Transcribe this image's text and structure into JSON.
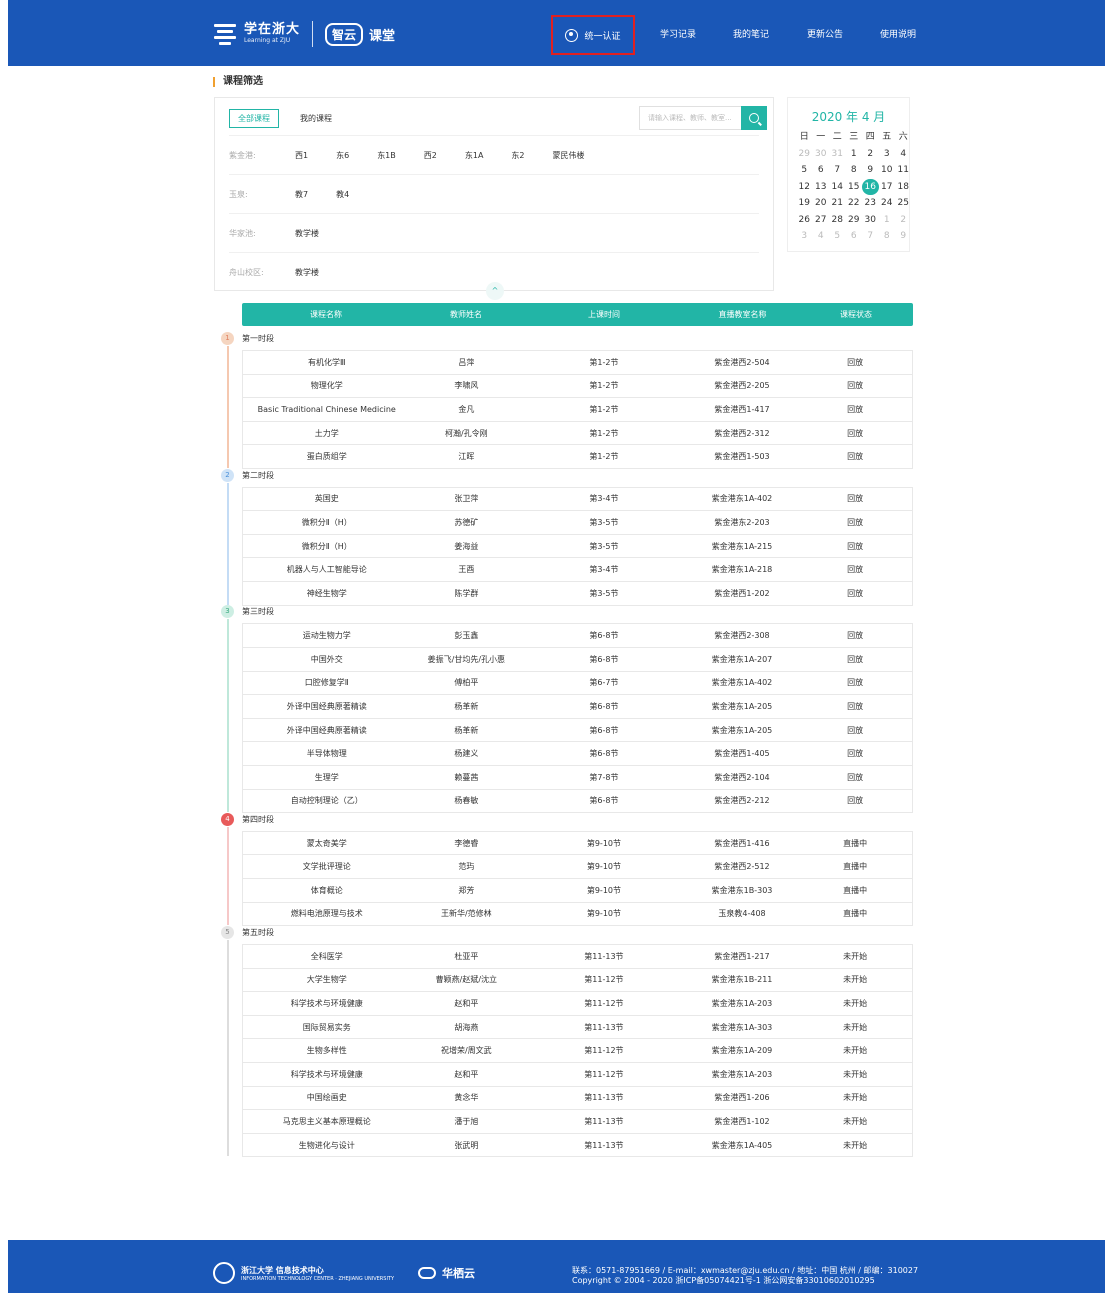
{
  "header": {
    "brand_text": "学在浙大",
    "brand_sub": "Learning at ZJU",
    "brand_zhiyun": "智云",
    "brand_ketang": "课堂",
    "auth_label": "统一认证",
    "nav": [
      "学习记录",
      "我的笔记",
      "更新公告",
      "使用说明"
    ]
  },
  "filter": {
    "title": "课程筛选",
    "tabs": [
      "全部课程",
      "我的课程"
    ],
    "search_placeholder": "请输入课程、教师、教室...",
    "rows": [
      {
        "label": "紫金港:",
        "options": [
          "西1",
          "东6",
          "东1B",
          "西2",
          "东1A",
          "东2",
          "蒙民伟楼"
        ]
      },
      {
        "label": "玉泉:",
        "options": [
          "教7",
          "教4"
        ]
      },
      {
        "label": "华家池:",
        "options": [
          "教学楼"
        ]
      },
      {
        "label": "舟山校区:",
        "options": [
          "教学楼"
        ]
      }
    ],
    "collapse_icon": "^"
  },
  "calendar": {
    "title": "2020 年 4 月",
    "weekdays": [
      "日",
      "一",
      "二",
      "三",
      "四",
      "五",
      "六"
    ],
    "days": [
      {
        "d": "29",
        "dim": true
      },
      {
        "d": "30",
        "dim": true
      },
      {
        "d": "31",
        "dim": true
      },
      {
        "d": "1"
      },
      {
        "d": "2"
      },
      {
        "d": "3"
      },
      {
        "d": "4"
      },
      {
        "d": "5"
      },
      {
        "d": "6"
      },
      {
        "d": "7"
      },
      {
        "d": "8"
      },
      {
        "d": "9"
      },
      {
        "d": "10"
      },
      {
        "d": "11"
      },
      {
        "d": "12"
      },
      {
        "d": "13"
      },
      {
        "d": "14"
      },
      {
        "d": "15"
      },
      {
        "d": "16",
        "today": true
      },
      {
        "d": "17"
      },
      {
        "d": "18"
      },
      {
        "d": "19"
      },
      {
        "d": "20"
      },
      {
        "d": "21"
      },
      {
        "d": "22"
      },
      {
        "d": "23"
      },
      {
        "d": "24"
      },
      {
        "d": "25"
      },
      {
        "d": "26"
      },
      {
        "d": "27"
      },
      {
        "d": "28"
      },
      {
        "d": "29"
      },
      {
        "d": "30"
      },
      {
        "d": "1",
        "dim": true
      },
      {
        "d": "2",
        "dim": true
      },
      {
        "d": "3",
        "dim": true
      },
      {
        "d": "4",
        "dim": true
      },
      {
        "d": "5",
        "dim": true
      },
      {
        "d": "6",
        "dim": true
      },
      {
        "d": "7",
        "dim": true
      },
      {
        "d": "8",
        "dim": true
      },
      {
        "d": "9",
        "dim": true
      }
    ]
  },
  "table": {
    "headers": [
      "课程名称",
      "教师姓名",
      "上课时间",
      "直播教室名称",
      "课程状态"
    ],
    "periods": [
      {
        "num": "1",
        "label": "第一时段",
        "color": "#f5d5c0",
        "badge_text": "#e08060",
        "line": "#f5c8b0",
        "rows": [
          [
            "有机化学Ⅲ",
            "吕萍",
            "第1-2节",
            "紫金港西2-504",
            "回放"
          ],
          [
            "物理化学",
            "李啸风",
            "第1-2节",
            "紫金港西2-205",
            "回放"
          ],
          [
            "Basic Traditional Chinese Medicine",
            "金凡",
            "第1-2节",
            "紫金港西1-417",
            "回放"
          ],
          [
            "土力学",
            "柯瀚/孔令刚",
            "第1-2节",
            "紫金港西2-312",
            "回放"
          ],
          [
            "蛋白质组学",
            "江晖",
            "第1-2节",
            "紫金港西1-503",
            "回放"
          ]
        ]
      },
      {
        "num": "2",
        "label": "第二时段",
        "color": "#cfe3f7",
        "badge_text": "#4a90d9",
        "line": "#c4dcf5",
        "rows": [
          [
            "英国史",
            "张卫萍",
            "第3-4节",
            "紫金港东1A-402",
            "回放"
          ],
          [
            "微积分Ⅱ（H）",
            "苏德矿",
            "第3-5节",
            "紫金港东2-203",
            "回放"
          ],
          [
            "微积分Ⅱ（H）",
            "姜海益",
            "第3-5节",
            "紫金港东1A-215",
            "回放"
          ],
          [
            "机器人与人工智能导论",
            "王酉",
            "第3-4节",
            "紫金港东1A-218",
            "回放"
          ],
          [
            "神经生物学",
            "陈学群",
            "第3-5节",
            "紫金港西1-202",
            "回放"
          ]
        ]
      },
      {
        "num": "3",
        "label": "第三时段",
        "color": "#cdeee3",
        "badge_text": "#3aaa80",
        "line": "#bfe8da",
        "rows": [
          [
            "运动生物力学",
            "彭玉鑫",
            "第6-8节",
            "紫金港西2-308",
            "回放"
          ],
          [
            "中国外交",
            "姜振飞/甘均先/孔小惠",
            "第6-8节",
            "紫金港东1A-207",
            "回放"
          ],
          [
            "口腔修复学Ⅱ",
            "傅柏平",
            "第6-7节",
            "紫金港东1A-402",
            "回放"
          ],
          [
            "外译中国经典原著精读",
            "杨革新",
            "第6-8节",
            "紫金港东1A-205",
            "回放"
          ],
          [
            "外译中国经典原著精读",
            "杨革新",
            "第6-8节",
            "紫金港东1A-205",
            "回放"
          ],
          [
            "半导体物理",
            "杨建义",
            "第6-8节",
            "紫金港西1-405",
            "回放"
          ],
          [
            "生理学",
            "赖蔓茜",
            "第7-8节",
            "紫金港西2-104",
            "回放"
          ],
          [
            "自动控制理论（乙）",
            "杨春敏",
            "第6-8节",
            "紫金港西2-212",
            "回放"
          ]
        ]
      },
      {
        "num": "4",
        "label": "第四时段",
        "color": "#e85a5a",
        "badge_text": "#ffffff",
        "line": "#f6c8c8",
        "rows": [
          [
            "蒙太奇美学",
            "李德睿",
            "第9-10节",
            "紫金港西1-416",
            "直播中"
          ],
          [
            "文学批评理论",
            "范玙",
            "第9-10节",
            "紫金港西2-512",
            "直播中"
          ],
          [
            "体育概论",
            "郑芳",
            "第9-10节",
            "紫金港东1B-303",
            "直播中"
          ],
          [
            "燃料电池原理与技术",
            "王新华/范修林",
            "第9-10节",
            "玉泉教4-408",
            "直播中"
          ]
        ]
      },
      {
        "num": "5",
        "label": "第五时段",
        "color": "#e6e6e6",
        "badge_text": "#888888",
        "line": "#dddddd",
        "rows": [
          [
            "全科医学",
            "杜亚平",
            "第11-13节",
            "紫金港西1-217",
            "未开始"
          ],
          [
            "大学生物学",
            "曹颖燕/赵斌/沈立",
            "第11-12节",
            "紫金港东1B-211",
            "未开始"
          ],
          [
            "科学技术与环境健康",
            "赵和平",
            "第11-12节",
            "紫金港东1A-203",
            "未开始"
          ],
          [
            "国际贸易实务",
            "胡海燕",
            "第11-13节",
            "紫金港东1A-303",
            "未开始"
          ],
          [
            "生物多样性",
            "祝增荣/周文武",
            "第11-12节",
            "紫金港东1A-209",
            "未开始"
          ],
          [
            "科学技术与环境健康",
            "赵和平",
            "第11-12节",
            "紫金港东1A-203",
            "未开始"
          ],
          [
            "中国绘画史",
            "黄念华",
            "第11-13节",
            "紫金港西1-206",
            "未开始"
          ],
          [
            "马克思主义基本原理概论",
            "潘于旭",
            "第11-13节",
            "紫金港西1-102",
            "未开始"
          ],
          [
            "生物进化与设计",
            "张武明",
            "第11-13节",
            "紫金港东1A-405",
            "未开始"
          ]
        ]
      }
    ]
  },
  "footer": {
    "org1": "浙江大学 信息技术中心",
    "org1_sub": "INFORMATION TECHNOLOGY CENTER · ZHEJIANG UNIVERSITY",
    "org2": "华栖云",
    "contact": "联系：0571-87951669 / E-mail：xwmaster@zju.edu.cn / 地址：中国 杭州 / 邮编：310027",
    "copyright": "Copyright © 2004 - 2020 浙ICP备05074421号-1 浙公网安备33010602010295"
  }
}
